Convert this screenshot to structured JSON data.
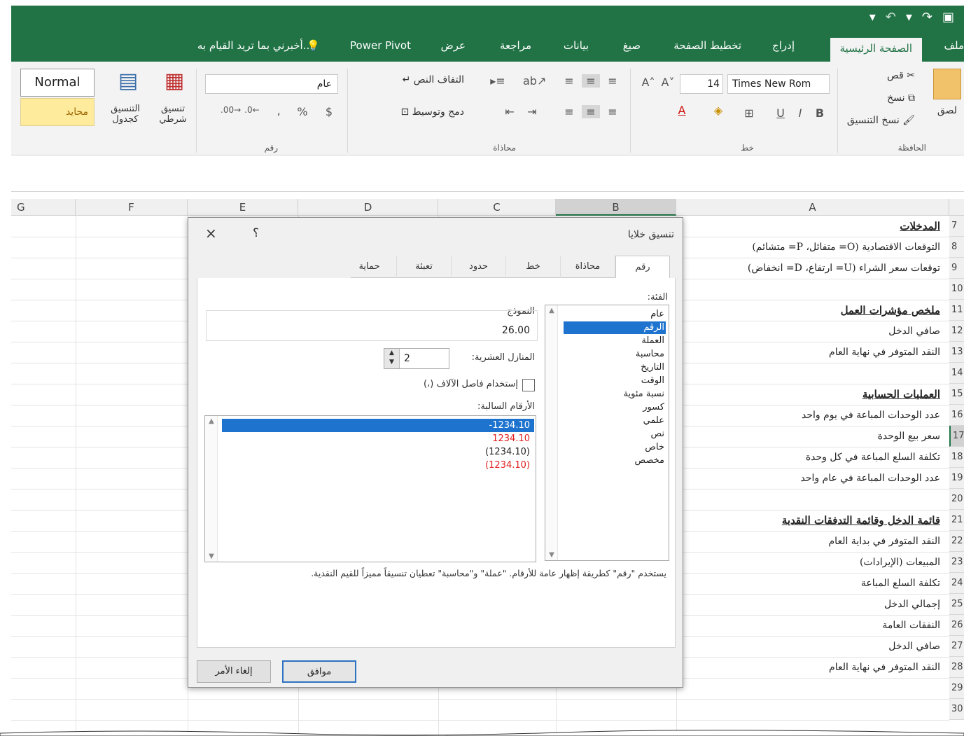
{
  "qat": {
    "save_icon": "save-icon",
    "redo_icon": "redo-icon",
    "undo_icon": "undo-icon"
  },
  "tabs": [
    {
      "label": "ملف"
    },
    {
      "label": "الصفحة الرئيسية"
    },
    {
      "label": "إدراج"
    },
    {
      "label": "تخطيط الصفحة"
    },
    {
      "label": "صيغ"
    },
    {
      "label": "بيانات"
    },
    {
      "label": "مراجعة"
    },
    {
      "label": "عرض"
    },
    {
      "label": "Power Pivot"
    },
    {
      "label": "أخبرني بما تريد القيام به..."
    }
  ],
  "ribbon": {
    "clipboard": {
      "paste": "لصق",
      "cut": "قص",
      "copy": "نسخ",
      "format_painter": "نسخ التنسيق",
      "group": "الحافظة"
    },
    "font": {
      "name": "Times New Rom",
      "size": "14",
      "bold": "B",
      "italic": "I",
      "underline": "U",
      "group": "خط"
    },
    "alignment": {
      "wrap": "التفاف النص",
      "merge": "دمج وتوسيط",
      "group": "محاذاة"
    },
    "number": {
      "format": "عام",
      "currency": "$",
      "percent": "%",
      "comma": "،",
      "group": "رقم"
    },
    "styles": {
      "conditional": "تنسيق شرطي",
      "as_table": "التنسيق كجدول",
      "normal": "Normal",
      "neutral": "محايد"
    }
  },
  "columns": [
    "A",
    "B",
    "C",
    "D",
    "E",
    "F",
    "G"
  ],
  "rows": [
    {
      "num": "7",
      "text": "المدخلات",
      "head": true
    },
    {
      "num": "8",
      "text": "التوقعات الاقتصادية (O= متفائل، P= متشائم)",
      "head": false
    },
    {
      "num": "9",
      "text": "توقعات سعر الشراء (U= ارتفاع، D= انخفاض)",
      "head": false
    },
    {
      "num": "10",
      "text": "",
      "head": false
    },
    {
      "num": "11",
      "text": "ملخص مؤشرات العمل",
      "head": true
    },
    {
      "num": "12",
      "text": "صافي الدخل",
      "head": false
    },
    {
      "num": "13",
      "text": "النقد المتوفر في نهاية العام",
      "head": false
    },
    {
      "num": "14",
      "text": "",
      "head": false
    },
    {
      "num": "15",
      "text": "العمليات الحسابية",
      "head": true
    },
    {
      "num": "16",
      "text": "عدد الوحدات المباعة في يوم واحد",
      "head": false
    },
    {
      "num": "17",
      "text": "سعر بيع الوحدة",
      "head": false
    },
    {
      "num": "18",
      "text": "تكلفة السلع المباعة في كل وحدة",
      "head": false
    },
    {
      "num": "19",
      "text": "عدد الوحدات المباعة في عام واحد",
      "head": false
    },
    {
      "num": "20",
      "text": "",
      "head": false
    },
    {
      "num": "21",
      "text": "قائمة الدخل وقائمة التدفقات النقدية",
      "head": true
    },
    {
      "num": "22",
      "text": "النقد المتوفر في بداية العام",
      "head": false
    },
    {
      "num": "23",
      "text": "المبيعات (الإيرادات)",
      "head": false
    },
    {
      "num": "24",
      "text": "تكلفة السلع المباعة",
      "head": false
    },
    {
      "num": "25",
      "text": "إجمالي الدخل",
      "head": false
    },
    {
      "num": "26",
      "text": "النفقات العامة",
      "head": false
    },
    {
      "num": "27",
      "text": "صافي الدخل",
      "head": false
    },
    {
      "num": "28",
      "text": "النقد المتوفر في نهاية العام",
      "head": false
    },
    {
      "num": "29",
      "text": "",
      "head": false
    },
    {
      "num": "30",
      "text": "",
      "head": false
    }
  ],
  "dialog": {
    "title": "تنسيق خلايا",
    "help": "؟",
    "close": "×",
    "tabs": [
      "رقم",
      "محاذاة",
      "خط",
      "حدود",
      "تعبئة",
      "حماية"
    ],
    "category_label": "الفئة:",
    "categories": [
      "عام",
      "الرقم",
      "العملة",
      "محاسبة",
      "التاريخ",
      "الوقت",
      "نسبة مئوية",
      "كسور",
      "علمي",
      "نص",
      "خاص",
      "مخصص"
    ],
    "selected_category": "الرقم",
    "sample_label": "النموذج",
    "sample_value": "26.00",
    "decimal_label": "المنازل العشرية:",
    "decimal_value": "2",
    "separator_label": "إستخدام فاصل الآلاف (،)",
    "negative_label": "الأرقام السالبة:",
    "negatives": [
      {
        "text": "-1234.10",
        "color": "#ffffff"
      },
      {
        "text": "1234.10",
        "color": "#e02020"
      },
      {
        "text": "(1234.10)",
        "color": "#222222"
      },
      {
        "text": "(1234.10)",
        "color": "#e02020"
      }
    ],
    "description": "يستخدم \"رقم\" كطريقة إظهار عامة للأرقام. \"عملة\" و\"محاسبة\" تعطيان تنسيقاً مميزاً للقيم النقدية.",
    "ok": "موافق",
    "cancel": "إلغاء الأمر"
  },
  "colors": {
    "excel_green": "#217346",
    "selection_blue": "#1e73cf"
  }
}
